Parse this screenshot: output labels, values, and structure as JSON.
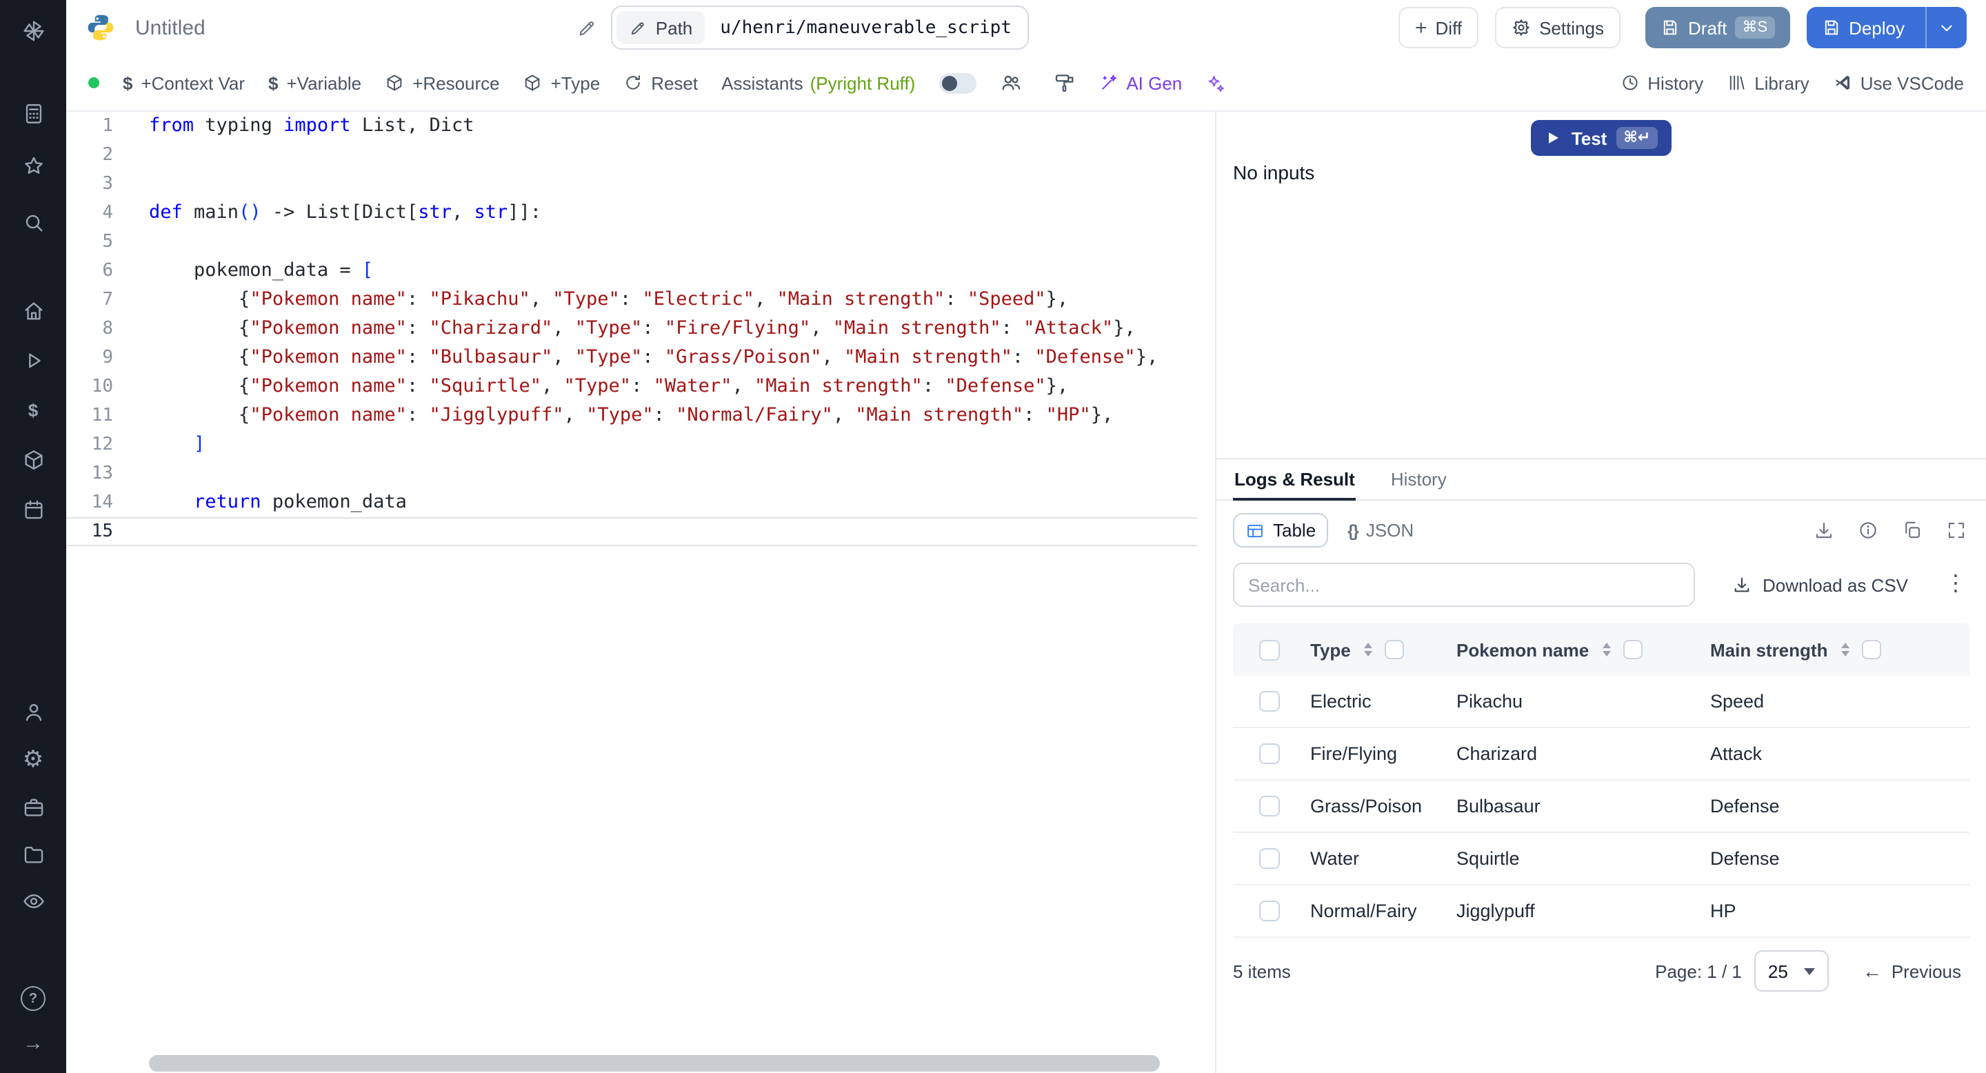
{
  "icons": {
    "dollar": "$",
    "braces": "{}",
    "kebab": "⋮",
    "arrow_left": "←",
    "arrow_right": "→",
    "help": "?",
    "gear": "⚙",
    "plus": "+"
  },
  "sidebar": {
    "icons": [
      "windmill-logo",
      "apps",
      "star",
      "search",
      "home",
      "runs",
      "variables",
      "resources",
      "schedules",
      "user",
      "settings",
      "workers",
      "folders",
      "audit",
      "help",
      "expand"
    ]
  },
  "topbar": {
    "title": "Untitled",
    "path_label": "Path",
    "path_value": "u/henri/maneuverable_script",
    "diff": "Diff",
    "settings": "Settings",
    "draft": "Draft",
    "draft_kbd": "⌘S",
    "deploy": "Deploy"
  },
  "toolbar": {
    "context_var": "+Context Var",
    "variable": "+Variable",
    "resource": "+Resource",
    "type": "+Type",
    "reset": "Reset",
    "assistants": "Assistants",
    "assistants_detail": "(Pyright Ruff)",
    "ai_gen": "AI Gen",
    "history": "History",
    "library": "Library",
    "vscode": "Use VSCode"
  },
  "editor": {
    "active_line": 15,
    "lines": [
      [
        [
          "kw",
          "from"
        ],
        [
          "pl",
          " typing "
        ],
        [
          "kw",
          "import"
        ],
        [
          "pl",
          " List, Dict"
        ]
      ],
      [],
      [],
      [
        [
          "kw",
          "def"
        ],
        [
          "pl",
          " main"
        ],
        [
          "brk",
          "()"
        ],
        [
          "pl",
          " -> List[Dict["
        ],
        [
          "kw",
          "str"
        ],
        [
          "pl",
          ", "
        ],
        [
          "kw",
          "str"
        ],
        [
          "pl",
          "]]:"
        ]
      ],
      [],
      [
        [
          "pl",
          "    pokemon_data = "
        ],
        [
          "brk",
          "["
        ]
      ],
      [
        [
          "pl",
          "        {"
        ],
        [
          "str",
          "\"Pokemon name\""
        ],
        [
          "pl",
          ": "
        ],
        [
          "str",
          "\"Pikachu\""
        ],
        [
          "pl",
          ", "
        ],
        [
          "str",
          "\"Type\""
        ],
        [
          "pl",
          ": "
        ],
        [
          "str",
          "\"Electric\""
        ],
        [
          "pl",
          ", "
        ],
        [
          "str",
          "\"Main strength\""
        ],
        [
          "pl",
          ": "
        ],
        [
          "str",
          "\"Speed\""
        ],
        [
          "pl",
          "},"
        ]
      ],
      [
        [
          "pl",
          "        {"
        ],
        [
          "str",
          "\"Pokemon name\""
        ],
        [
          "pl",
          ": "
        ],
        [
          "str",
          "\"Charizard\""
        ],
        [
          "pl",
          ", "
        ],
        [
          "str",
          "\"Type\""
        ],
        [
          "pl",
          ": "
        ],
        [
          "str",
          "\"Fire/Flying\""
        ],
        [
          "pl",
          ", "
        ],
        [
          "str",
          "\"Main strength\""
        ],
        [
          "pl",
          ": "
        ],
        [
          "str",
          "\"Attack\""
        ],
        [
          "pl",
          "},"
        ]
      ],
      [
        [
          "pl",
          "        {"
        ],
        [
          "str",
          "\"Pokemon name\""
        ],
        [
          "pl",
          ": "
        ],
        [
          "str",
          "\"Bulbasaur\""
        ],
        [
          "pl",
          ", "
        ],
        [
          "str",
          "\"Type\""
        ],
        [
          "pl",
          ": "
        ],
        [
          "str",
          "\"Grass/Poison\""
        ],
        [
          "pl",
          ", "
        ],
        [
          "str",
          "\"Main strength\""
        ],
        [
          "pl",
          ": "
        ],
        [
          "str",
          "\"Defense\""
        ],
        [
          "pl",
          "},"
        ]
      ],
      [
        [
          "pl",
          "        {"
        ],
        [
          "str",
          "\"Pokemon name\""
        ],
        [
          "pl",
          ": "
        ],
        [
          "str",
          "\"Squirtle\""
        ],
        [
          "pl",
          ", "
        ],
        [
          "str",
          "\"Type\""
        ],
        [
          "pl",
          ": "
        ],
        [
          "str",
          "\"Water\""
        ],
        [
          "pl",
          ", "
        ],
        [
          "str",
          "\"Main strength\""
        ],
        [
          "pl",
          ": "
        ],
        [
          "str",
          "\"Defense\""
        ],
        [
          "pl",
          "},"
        ]
      ],
      [
        [
          "pl",
          "        {"
        ],
        [
          "str",
          "\"Pokemon name\""
        ],
        [
          "pl",
          ": "
        ],
        [
          "str",
          "\"Jigglypuff\""
        ],
        [
          "pl",
          ", "
        ],
        [
          "str",
          "\"Type\""
        ],
        [
          "pl",
          ": "
        ],
        [
          "str",
          "\"Normal/Fairy\""
        ],
        [
          "pl",
          ", "
        ],
        [
          "str",
          "\"Main strength\""
        ],
        [
          "pl",
          ": "
        ],
        [
          "str",
          "\"HP\""
        ],
        [
          "pl",
          "},"
        ]
      ],
      [
        [
          "pl",
          "    "
        ],
        [
          "brk",
          "]"
        ]
      ],
      [],
      [
        [
          "pl",
          "    "
        ],
        [
          "kw",
          "return"
        ],
        [
          "pl",
          " pokemon_data"
        ]
      ],
      []
    ]
  },
  "run": {
    "test": "Test",
    "test_kbd": "⌘↵",
    "no_inputs": "No inputs"
  },
  "result": {
    "tabs": [
      "Logs & Result",
      "History"
    ],
    "active_tab": "Logs & Result",
    "view_toggle": [
      "Table",
      "JSON"
    ],
    "active_view": "Table",
    "search_placeholder": "Search...",
    "download_csv": "Download as CSV",
    "table": {
      "columns": [
        "Type",
        "Pokemon name",
        "Main strength"
      ],
      "rows": [
        [
          "Electric",
          "Pikachu",
          "Speed"
        ],
        [
          "Fire/Flying",
          "Charizard",
          "Attack"
        ],
        [
          "Grass/Poison",
          "Bulbasaur",
          "Defense"
        ],
        [
          "Water",
          "Squirtle",
          "Defense"
        ],
        [
          "Normal/Fairy",
          "Jigglypuff",
          "HP"
        ]
      ]
    },
    "footer": {
      "items": "5 items",
      "page": "Page: 1 / 1",
      "page_size": "25",
      "previous": "Previous"
    }
  }
}
